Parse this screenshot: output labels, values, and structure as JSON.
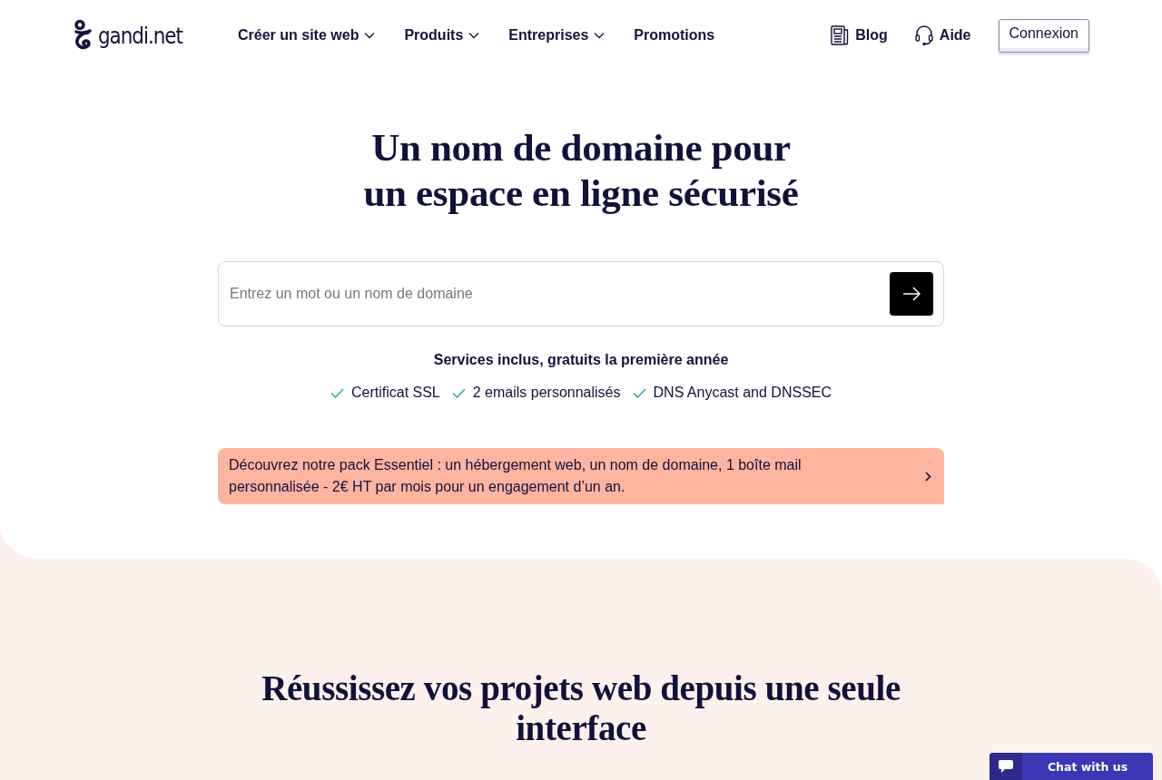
{
  "header": {
    "logo": "gandi.net",
    "nav": [
      {
        "label": "Créer un site web",
        "dropdown": true
      },
      {
        "label": "Produits",
        "dropdown": true
      },
      {
        "label": "Entreprises",
        "dropdown": true
      },
      {
        "label": "Promotions",
        "dropdown": false
      }
    ],
    "links": [
      {
        "label": "Blog",
        "kind": "blog"
      },
      {
        "label": "Aide",
        "kind": "help"
      }
    ],
    "login_button": "Connexion"
  },
  "hero": {
    "title_lines": [
      "Un nom de domaine pour",
      "un espace en ligne sécurisé"
    ],
    "search": {
      "placeholder": "Entrez un mot ou un nom de domaine"
    },
    "services_title": "Services inclus, gratuits la première année",
    "services": [
      "Certificat SSL",
      "2 emails personnalisés",
      "DNS Anycast and DNSSEC"
    ],
    "promo": {
      "text": "Découvrez notre pack Essentiel : un hébergement web, un nom de domaine, 1 boîte mail personnalisée - 2€ HT par mois pour un engagement d’un an."
    }
  },
  "features": {
    "title_lines": [
      "Réussissez vos projets web depuis une seule",
      "interface"
    ]
  },
  "chat_button": {
    "label": "Chat with us"
  }
}
